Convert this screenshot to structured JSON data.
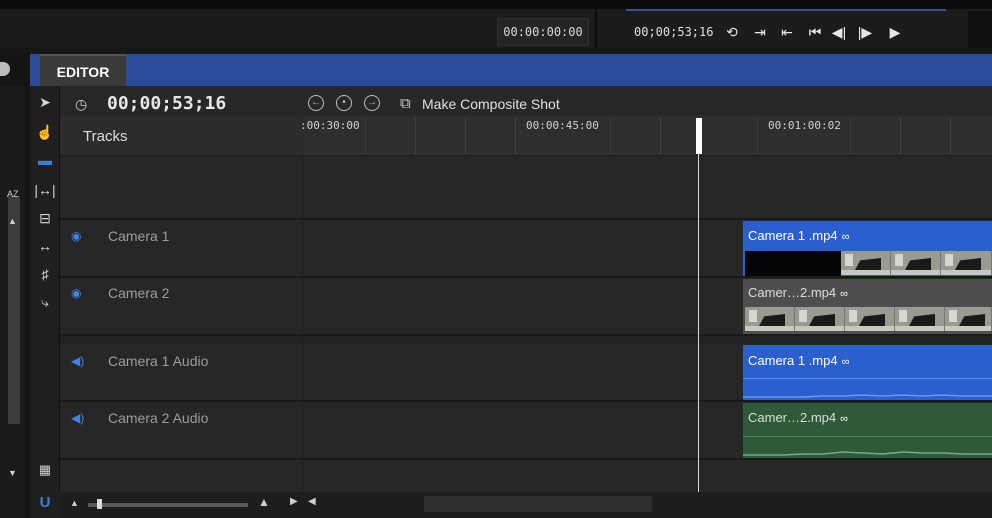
{
  "top": {
    "source_timecode": "00:00:00:00",
    "program_timecode": "00;00;53;16",
    "transport_icons": [
      "loop-icon",
      "mark-in-icon",
      "mark-out-icon",
      "go-to-start-icon",
      "step-back-icon",
      "step-forward-icon",
      "play-icon"
    ]
  },
  "editor": {
    "tab_label": "EDITOR",
    "timecode": "00;00;53;16",
    "composite_label": "Make Composite Shot",
    "tracks_header": "Tracks",
    "ruler_labels": [
      ":00:30:00",
      "00:00:45:00",
      "00:01:00:02"
    ],
    "tracks": [
      {
        "name": "Camera 1",
        "type": "video",
        "clip": "Camera 1 .mp4"
      },
      {
        "name": "Camera 2",
        "type": "video",
        "clip": "Camer…2.mp4"
      },
      {
        "name": "Camera 1 Audio",
        "type": "audio",
        "clip": "Camera 1 .mp4"
      },
      {
        "name": "Camera 2 Audio",
        "type": "audio",
        "clip": "Camer…2.mp4"
      }
    ]
  },
  "sidebar": {
    "sort_label": "AZ"
  },
  "colors": {
    "accent_blue": "#2a4a9c",
    "clip_blue": "#2b5fd0",
    "clip_gray": "#4e4e4e",
    "clip_green": "#2e5a3a"
  }
}
